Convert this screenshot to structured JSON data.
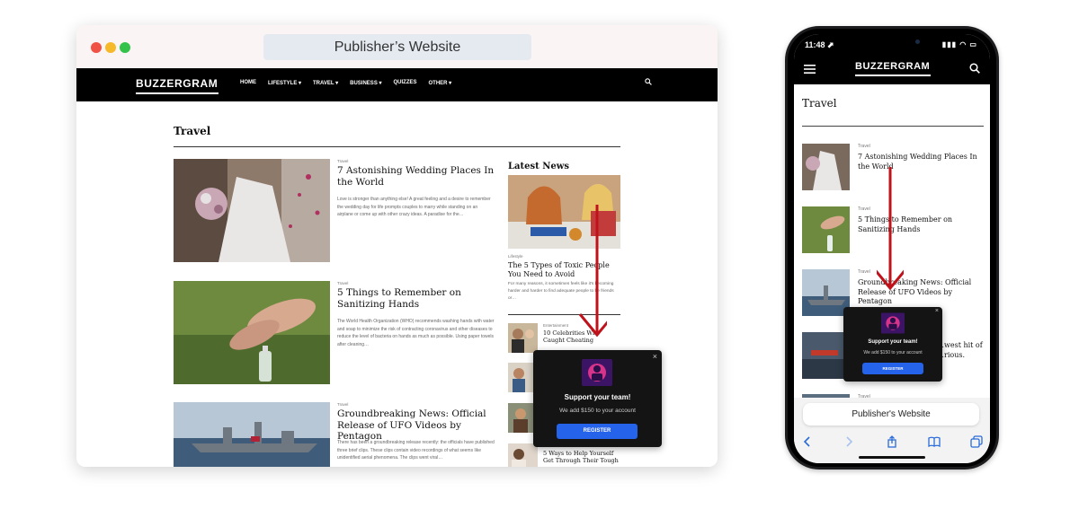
{
  "desktop": {
    "url_bar": "Publisher’s Website",
    "site": {
      "logo": "BUZZERGRAM",
      "nav": [
        "HOME",
        "LIFESTYLE ▾",
        "TRAVEL ▾",
        "BUSINESS ▾",
        "QUIZZES",
        "OTHER ▾"
      ]
    },
    "section_title": "Travel",
    "articles": [
      {
        "category": "Travel",
        "title": "7 Astonishing Wedding Places In the World",
        "excerpt": "Love is stronger than anything else! A great feeling and a desire to remember the wedding day for life prompts couples to marry while standing on an airplane or come up with other crazy ideas. A paradise for the…"
      },
      {
        "category": "Travel",
        "title": "5 Things to Remember on Sanitizing Hands",
        "excerpt": "The World Health Organization (WHO) recommends washing hands with water and soap to minimize the risk of contracting coronavirus and other diseases to reduce the level of bacteria on hands as much as possible. Using paper towels after cleaning…"
      },
      {
        "category": "Travel",
        "title": "Groundbreaking News: Official Release of UFO Videos by Pentagon",
        "excerpt": "There has been a groundbreaking release recently: the officials have published three brief clips. These clips contain video recordings of what seems like unidentified aerial phenomena. The clips went viral…"
      }
    ],
    "latest": {
      "heading": "Latest News",
      "hero_category": "Lifestyle",
      "hero_title": "The 5 Types of Toxic People You Need to Avoid",
      "hero_excerpt": "For many reasons, it sometimes feels like it's becoming harder and harder to find adequate people to be friends or…",
      "items": [
        {
          "category": "Entertainment",
          "title": "10 Celebrities Who Caught Cheating"
        },
        {
          "category": "",
          "title": ""
        },
        {
          "category": "",
          "title": ""
        },
        {
          "category": "",
          "title": "5 Ways to Help Yourself Get Through Their Tough"
        }
      ]
    },
    "popup": {
      "title": "Support your team!",
      "subtitle": "We add $150 to your account",
      "button": "REGISTER",
      "close": "×"
    }
  },
  "mobile": {
    "status_time": "11:48 ⬈",
    "status_icons": "▮▮▮ ◠ ▭",
    "logo": "BUZZERGRAM",
    "section_title": "Travel",
    "items": [
      {
        "category": "Travel",
        "title": "7 Astonishing Wedding Places In the World"
      },
      {
        "category": "Travel",
        "title": "5 Things to Remember on Sanitizing Hands"
      },
      {
        "category": "Travel",
        "title": "Groundbreaking News: Official Release of UFO Videos by Pentagon"
      },
      {
        "category": "",
        "title": "…west hit of …rious."
      },
      {
        "category": "Travel",
        "title": ""
      }
    ],
    "popup": {
      "title": "Support your team!",
      "subtitle": "We add $150 to your account",
      "button": "REGISTER",
      "close": "×"
    },
    "url_bar": "Publisher's Website"
  },
  "colors": {
    "accent_button": "#2563eb",
    "arrow": "#c0121a",
    "nav_bg": "#000000"
  }
}
